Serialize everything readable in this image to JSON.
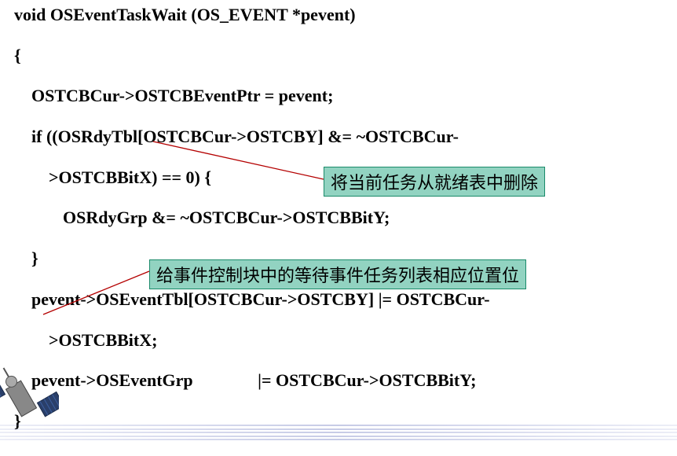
{
  "code": {
    "l0": "void OSEventTaskWait (OS_EVENT *pevent)",
    "l1": "{",
    "l2": "OSTCBCur->OSTCBEventPtr = pevent;",
    "l3": "if ((OSRdyTbl[OSTCBCur->OSTCBY] &= ~OSTCBCur-",
    "l4": ">OSTCBBitX) == 0) {",
    "l5": "OSRdyGrp &= ~OSTCBCur->OSTCBBitY;",
    "l6": "}",
    "l7": "pevent->OSEventTbl[OSTCBCur->OSTCBY] |= OSTCBCur-",
    "l8": ">OSTCBBitX;",
    "l9": "pevent->OSEventGrp               |= OSTCBCur->OSTCBBitY;",
    "l10": "}"
  },
  "annotations": {
    "a1": "将当前任务从就绪表中删除",
    "a2": "给事件控制块中的等待事件任务列表相应位置位"
  }
}
